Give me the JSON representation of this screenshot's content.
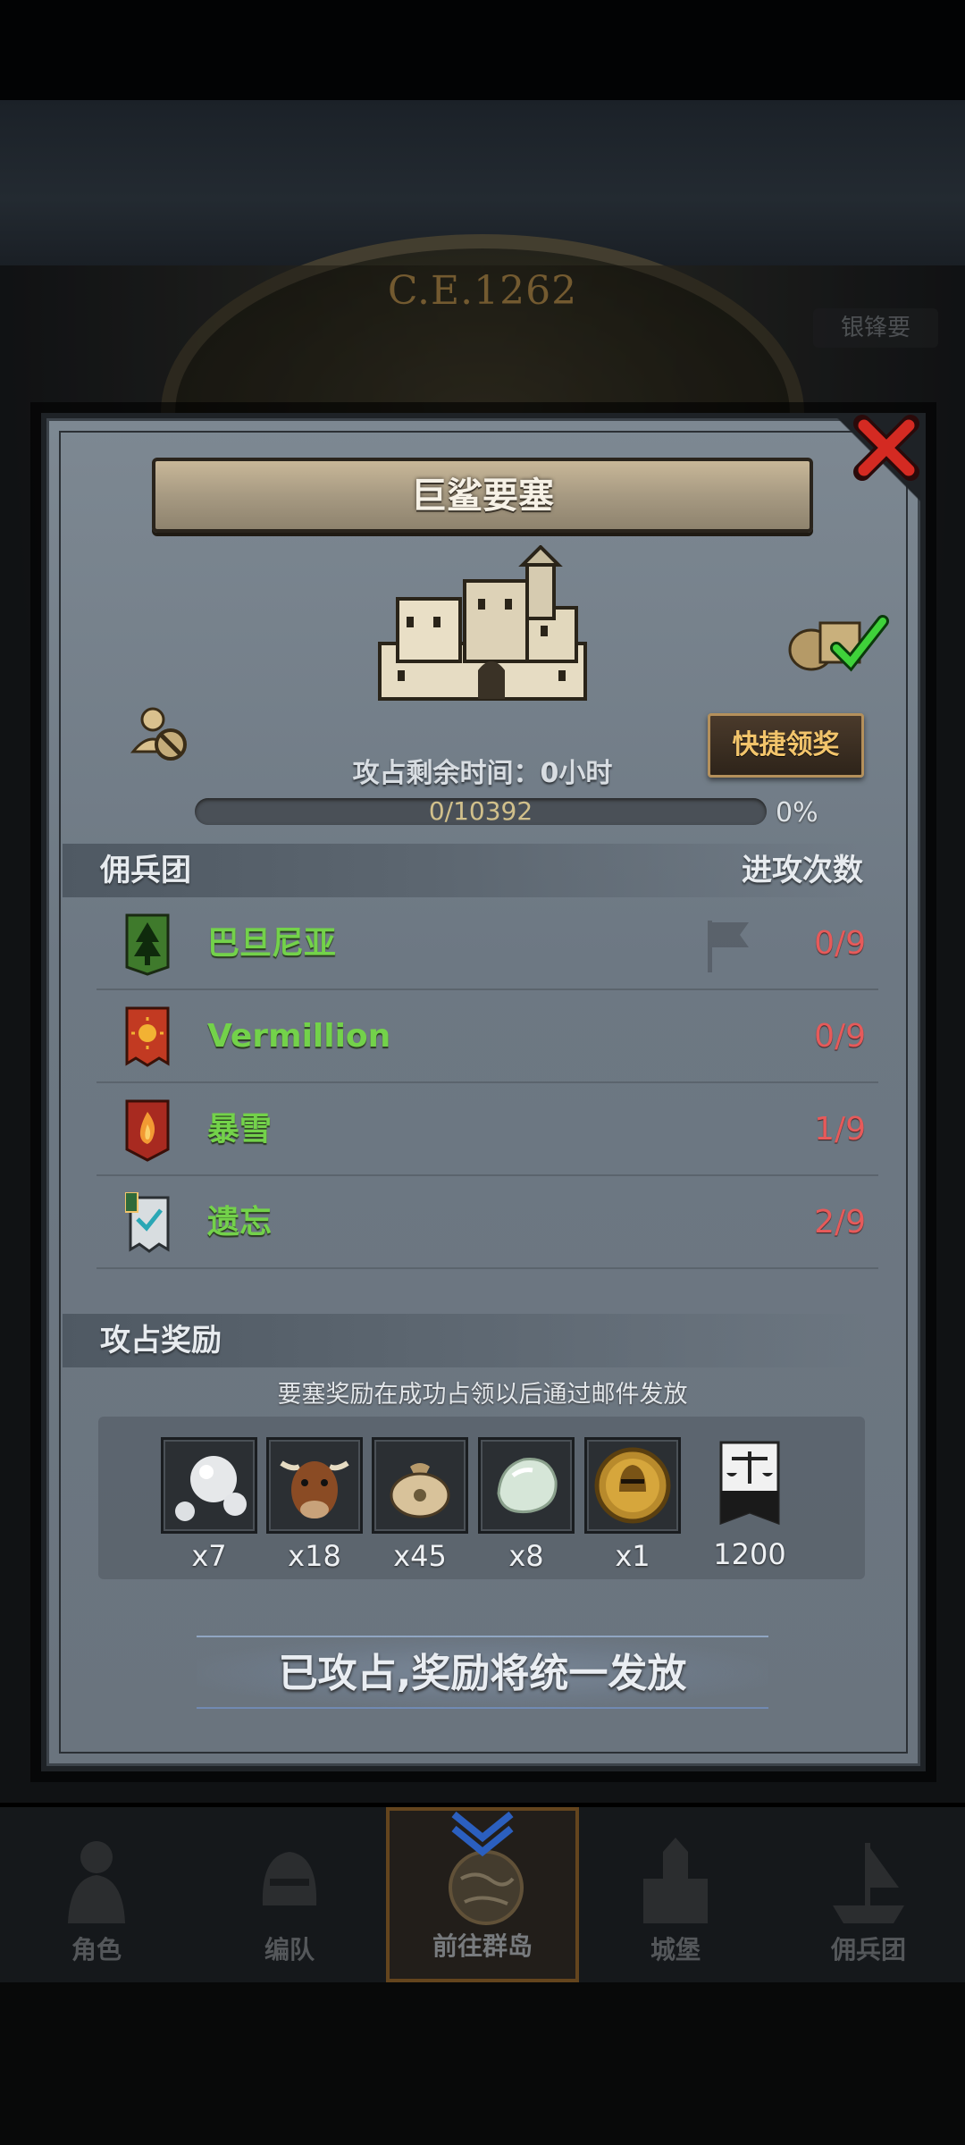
{
  "background": {
    "era_label": "C.E.1262",
    "side_tag": "银锋要"
  },
  "dialog": {
    "title": "巨鲨要塞",
    "quick_claim_label": "快捷领奖",
    "time_label": "攻占剩余时间：0小时",
    "progress": {
      "text": "0/10392",
      "current": 0,
      "total": 10392,
      "percent_label": "0%"
    },
    "mercenary_section": {
      "label": "佣兵团",
      "right_label": "进攻次数",
      "rows": [
        {
          "name": "巴旦尼亚",
          "count": "0/9",
          "banner": "pine-tree-banner",
          "banner_color": "#3f7a2c"
        },
        {
          "name": "Vermillion",
          "count": "0/9",
          "banner": "sun-banner",
          "banner_color": "#c23a22"
        },
        {
          "name": "暴雪",
          "count": "1/9",
          "banner": "flame-banner",
          "banner_color": "#a82a20"
        },
        {
          "name": "遗忘",
          "count": "2/9",
          "banner": "wave-banner",
          "banner_color": "#d8dde0"
        }
      ]
    },
    "reward_section": {
      "label": "攻占奖励",
      "note": "要塞奖励在成功占领以后通过邮件发放",
      "items": [
        {
          "icon": "pearl-icon",
          "qty": "x7"
        },
        {
          "icon": "ox-head-icon",
          "qty": "x18"
        },
        {
          "icon": "money-bag-icon",
          "qty": "x45"
        },
        {
          "icon": "jade-stone-icon",
          "qty": "x8"
        },
        {
          "icon": "knight-medal-icon",
          "qty": "x1"
        },
        {
          "icon": "justice-banner-icon",
          "qty": "1200"
        }
      ]
    },
    "status_text": "已攻占,奖励将统一发放"
  },
  "bottom_nav": {
    "tabs": [
      {
        "label": "角色",
        "icon": "knight-icon"
      },
      {
        "label": "编队",
        "icon": "helmet-icon"
      },
      {
        "label": "前往群岛",
        "icon": "globe-icon",
        "active": true
      },
      {
        "label": "城堡",
        "icon": "castle-icon"
      },
      {
        "label": "佣兵团",
        "icon": "ship-icon"
      }
    ]
  },
  "colors": {
    "name_green": "#73d24a",
    "count_red": "#e65a5a",
    "accent_gold": "#f2c46b"
  }
}
